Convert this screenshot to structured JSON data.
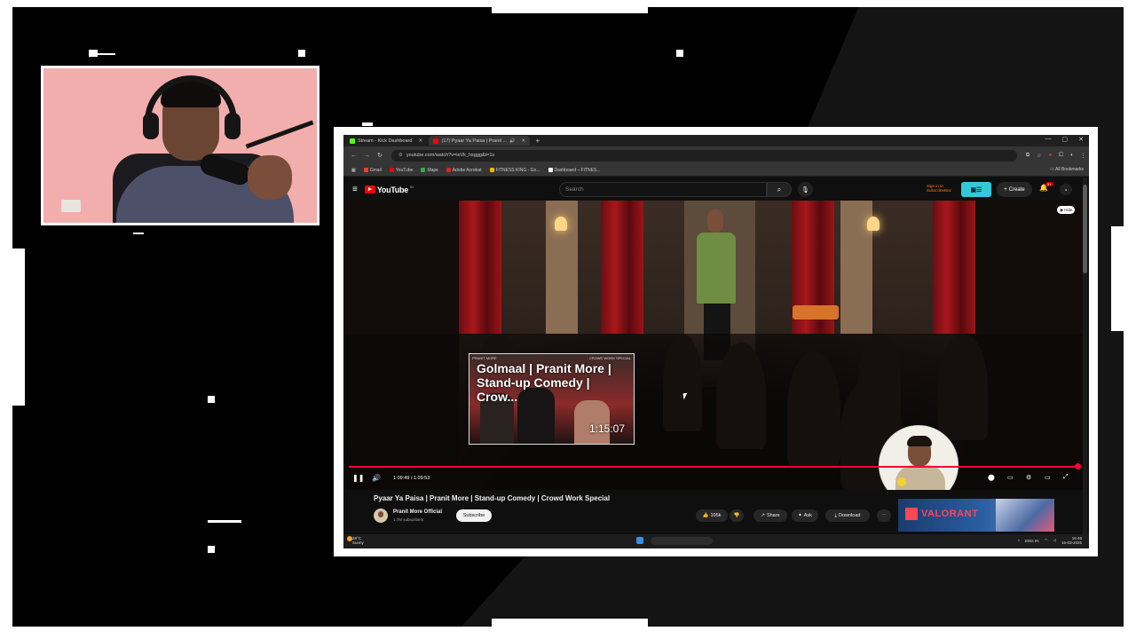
{
  "browser": {
    "tabs": [
      {
        "label": "Stream - Kick Dashboard",
        "color": "#53fc18",
        "active": false
      },
      {
        "label": "(17) Pyaar Ya Paisa | Pranit ...",
        "color": "#ff0000",
        "active": true
      }
    ],
    "url": "youtube.com/watch?v=ieVk_hsggg&t=1s",
    "bookmarks": [
      {
        "label": "Gmail",
        "color": "#ea4335"
      },
      {
        "label": "YouTube",
        "color": "#ff0000"
      },
      {
        "label": "Maps",
        "color": "#34a853"
      },
      {
        "label": "Adobe Acrobat",
        "color": "#d4271e"
      },
      {
        "label": "FITNESS KING - Go...",
        "color": "#f4b400"
      },
      {
        "label": "Dashboard – FITNES...",
        "color": "#ffffff"
      }
    ],
    "all_bookmarks": "All Bookmarks"
  },
  "youtube": {
    "logo_text": "YouTube",
    "country_code": "IN",
    "search_placeholder": "Search",
    "signin_text": "Sign in to SubscribeBox",
    "create_label": "Create",
    "notification_count": "9+",
    "hide_label": "Hide"
  },
  "endcard": {
    "tag_left": "PRANIT MORE",
    "tag_right": "CROWD WORK SPECIAL",
    "title": "Golmaal | Pranit More | Stand-up Comedy | Crow...",
    "duration": "1:15:07"
  },
  "player": {
    "current_time": "1:09:49",
    "total_time": "1:09:53",
    "progress": 0.999
  },
  "video": {
    "title": "Pyaar Ya Paisa | Pranit More | Stand-up Comedy | Crowd Work Special",
    "channel": "Pranit More Official",
    "subscribers": "1.7M subscribers",
    "subscribe_label": "Subscribe",
    "likes": "105k",
    "share_label": "Share",
    "ask_label": "Ask",
    "download_label": "Download"
  },
  "ad": {
    "brand": "VALORANT"
  },
  "taskbar": {
    "weather_temp": "28°C",
    "weather_cond": "Sunny",
    "lang": "ENG IN",
    "time": "16:48",
    "date": "16-03-2025"
  }
}
